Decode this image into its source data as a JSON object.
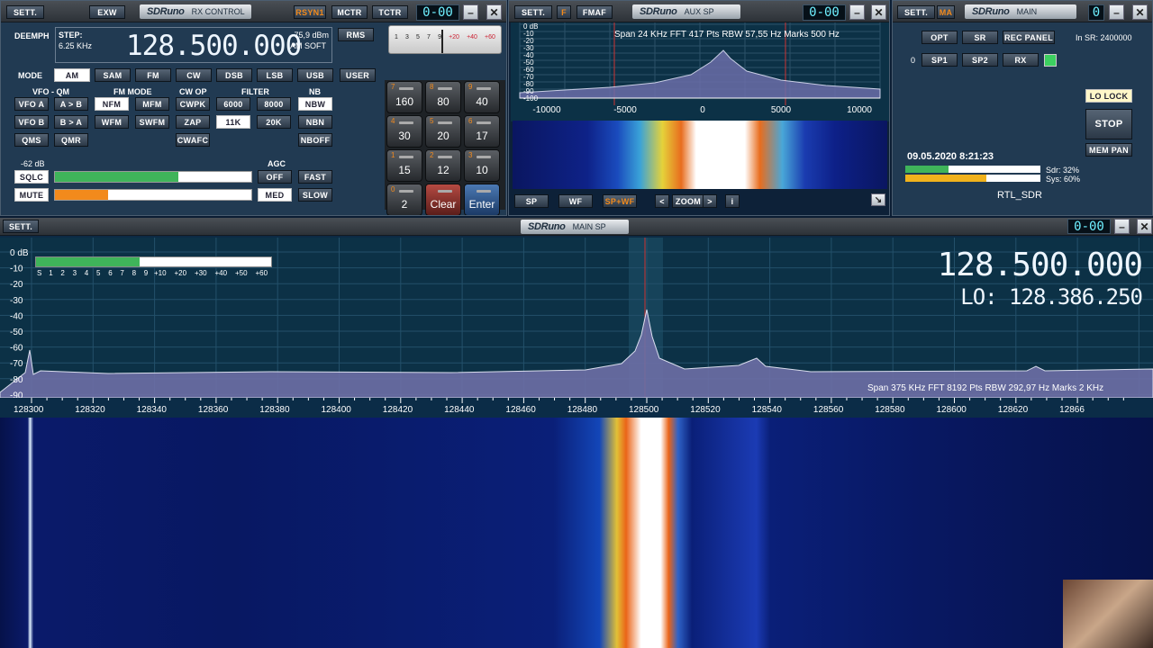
{
  "rx": {
    "sett": "SETT.",
    "exw": "EXW",
    "brand": "SDRuno",
    "title": "RX CONTROL",
    "rsyn": "RSYN1",
    "mctr": "MCTR",
    "tctr": "TCTR",
    "lcd": "0-00",
    "deemph": "DEEMPH",
    "step_label": "STEP:",
    "step": "6.25 KHz",
    "freq": "128.500.000",
    "dbm": "-75,9 dBm",
    "amsoft": "AM SOFT",
    "rms": "RMS",
    "mode_label": "MODE",
    "modes": [
      "AM",
      "SAM",
      "FM",
      "CW",
      "DSB",
      "LSB",
      "USB",
      "USER"
    ],
    "hdr_vfo": "VFO - QM",
    "hdr_fm": "FM MODE",
    "hdr_cw": "CW OP",
    "hdr_filter": "FILTER",
    "hdr_nb": "NB",
    "r1": [
      "VFO A",
      "A > B",
      "NFM",
      "MFM",
      "CWPK",
      "6000",
      "8000",
      "NBW"
    ],
    "r2": [
      "VFO B",
      "B > A",
      "WFM",
      "SWFM",
      "ZAP",
      "11K",
      "20K",
      "NBN"
    ],
    "r3": [
      "QMS",
      "QMR",
      "CWAFC",
      "NBOFF"
    ],
    "sq_db": "-62 dB",
    "agc": "AGC",
    "sqlc": "SQLC",
    "mute": "MUTE",
    "agc_btns": [
      "OFF",
      "FAST",
      "MED",
      "SLOW"
    ],
    "sq_level": 0.63,
    "vol_level": 0.27
  },
  "keypad": {
    "scale": [
      "1",
      "3",
      "5",
      "7",
      "9",
      "+20",
      "+40",
      "+60"
    ],
    "keys": [
      {
        "n": "7",
        "v": "160"
      },
      {
        "n": "8",
        "v": "80"
      },
      {
        "n": "9",
        "v": "40"
      },
      {
        "n": "4",
        "v": "30"
      },
      {
        "n": "5",
        "v": "20"
      },
      {
        "n": "6",
        "v": "17"
      },
      {
        "n": "1",
        "v": "15"
      },
      {
        "n": "2",
        "v": "12"
      },
      {
        "n": "3",
        "v": "10"
      },
      {
        "n": "0",
        "v": "2"
      },
      {
        "n": "",
        "v": "Clear"
      },
      {
        "n": "",
        "v": "Enter"
      }
    ]
  },
  "aux": {
    "sett": "SETT.",
    "f": "F",
    "fmaf": "FMAF",
    "brand": "SDRuno",
    "title": "AUX SP",
    "lcd": "0-00",
    "info": "Span 24 KHz   FFT 417 Pts   RBW 57,55 Hz   Marks 500 Hz",
    "dbticks": [
      "0 dB",
      "-10",
      "-20",
      "-30",
      "-40",
      "-50",
      "-60",
      "-70",
      "-80",
      "-90",
      "-100"
    ],
    "xticks": [
      "-10000",
      "-5000",
      "0",
      "5000",
      "10000"
    ],
    "btns": [
      "SP",
      "WF",
      "SP+WF",
      "<",
      "ZOOM",
      ">",
      "i"
    ]
  },
  "main": {
    "sett": "SETT.",
    "ma": "MA",
    "brand": "SDRuno",
    "title": "MAIN",
    "lcd": "0",
    "btns": [
      "OPT",
      "SR",
      "REC PANEL",
      "SP1",
      "SP2",
      "RX"
    ],
    "zero": "0",
    "insr": "In SR: 2400000",
    "lolock": "LO LOCK",
    "stop": "STOP",
    "mempan": "MEM PAN",
    "datetime": "09.05.2020 8:21:23",
    "sdr": "Sdr: 32%",
    "sys": "Sys: 60%",
    "device": "RTL_SDR",
    "sdr_level": 0.32,
    "sys_level": 0.6
  },
  "mainsp": {
    "sett": "SETT.",
    "brand": "SDRuno",
    "title": "MAIN SP",
    "lcd": "0-00",
    "freq": "128.500.000",
    "lo": "LO: 128.386.250",
    "dbticks": [
      "0 dB",
      "-10",
      "-20",
      "-30",
      "-40",
      "-50",
      "-60",
      "-70",
      "-80",
      "-90"
    ],
    "smeter": [
      "S",
      "1",
      "2",
      "3",
      "4",
      "5",
      "6",
      "7",
      "8",
      "9",
      "+10",
      "+20",
      "+30",
      "+40",
      "+50",
      "+60"
    ],
    "smeter_level": 0.44,
    "info": "Span 375 KHz   FFT 8192 Pts   RBW 292,97 Hz   Marks 2 KHz",
    "xticks": [
      "128300",
      "128320",
      "128340",
      "128360",
      "128380",
      "128400",
      "128420",
      "128440",
      "128460",
      "128480",
      "128500",
      "128520",
      "128540",
      "128560",
      "128580",
      "128600",
      "128620",
      "12866"
    ]
  },
  "colors": {
    "accent": "#f28a1c",
    "panel": "#213a52",
    "plot": "#0c3146",
    "meter": "#3fb45a"
  }
}
